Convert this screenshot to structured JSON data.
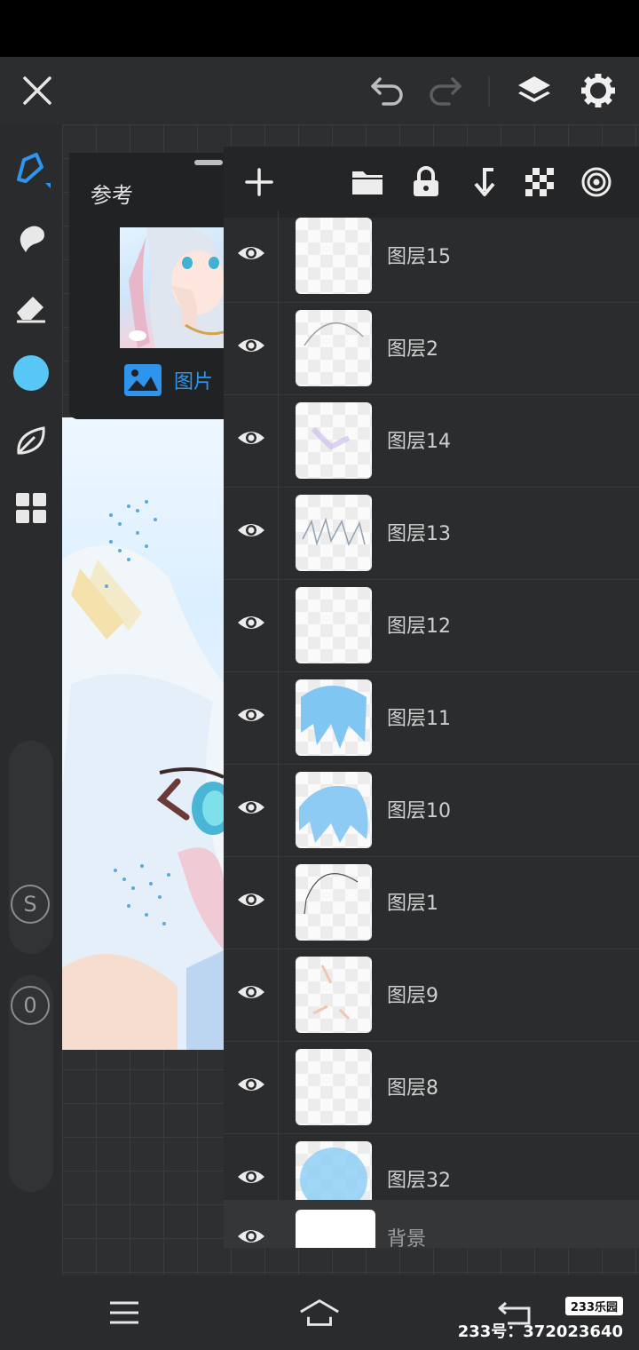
{
  "top_bar": {
    "close_icon": "close-icon",
    "undo_icon": "undo-icon",
    "redo_icon": "redo-icon",
    "layers_icon": "layers-icon",
    "settings_icon": "gear-icon"
  },
  "left_toolbar": {
    "tools": [
      "brush-icon",
      "smudge-icon",
      "eraser-icon",
      "color-swatch",
      "leaf-icon",
      "grid-icon"
    ],
    "current_color": "#58c7f5",
    "size_label": "S",
    "opacity_label": "0"
  },
  "reference_panel": {
    "title": "参考",
    "image_label": "图片"
  },
  "layers_toolbar": {
    "icons": [
      "add-icon",
      "folder-icon",
      "lock-icon",
      "merge-down-icon",
      "transparency-icon",
      "target-icon"
    ]
  },
  "layers": [
    {
      "name": "图层15"
    },
    {
      "name": "图层2"
    },
    {
      "name": "图层14"
    },
    {
      "name": "图层13"
    },
    {
      "name": "图层12"
    },
    {
      "name": "图层11"
    },
    {
      "name": "图层10"
    },
    {
      "name": "图层1"
    },
    {
      "name": "图层9"
    },
    {
      "name": "图层8"
    },
    {
      "name": "图层32"
    }
  ],
  "background_layer": {
    "name": "背景"
  },
  "nav_bar": {
    "menu_icon": "menu-icon",
    "home_icon": "home-icon",
    "back_icon": "back-icon"
  },
  "watermark": {
    "logo": "233乐园",
    "id_text": "233号：372023640"
  },
  "colors": {
    "accent": "#2f95ec",
    "panel_bg": "#2b2c2e",
    "toolbar_bg": "#242527"
  }
}
